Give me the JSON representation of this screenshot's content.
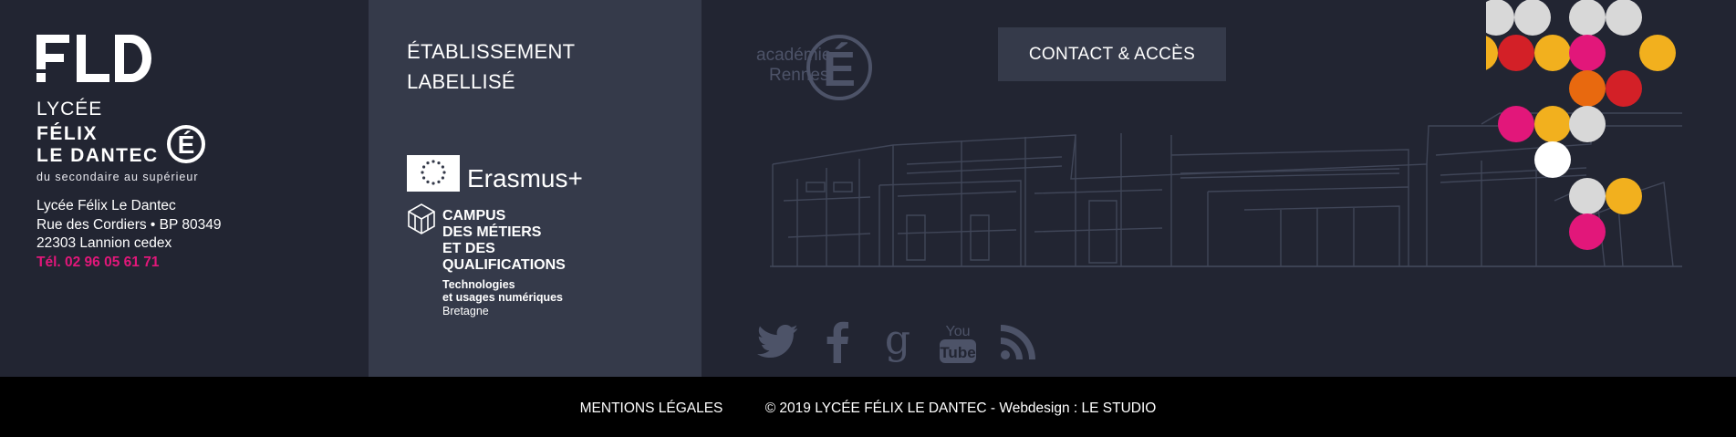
{
  "brand": {
    "logo_text": "FLD",
    "lycee": "LYCÉE",
    "name_line1": "FÉLIX",
    "name_line2": "LE DANTEC",
    "tagline": "du secondaire au supérieur",
    "e_mark": "É"
  },
  "address": {
    "line1": "Lycée Félix Le Dantec",
    "line2": "Rue des Cordiers • BP 80349",
    "line3": "22303 Lannion cedex",
    "phone": "Tél. 02 96 05 61 71"
  },
  "labels": {
    "title_line1": "ÉTABLISSEMENT",
    "title_line2": "LABELLISÉ",
    "erasmus": "Erasmus+",
    "campus_line1": "CAMPUS",
    "campus_line2": "DES MÉTIERS",
    "campus_line3": "ET DES",
    "campus_line4": "QUALIFICATIONS",
    "campus_line5": "Technologies",
    "campus_line6": "et usages numériques",
    "campus_line7": "Bretagne"
  },
  "academie": {
    "line1": "académie",
    "line2": "Rennes",
    "e_mark": "É"
  },
  "contact_button": "CONTACT & ACCÈS",
  "socials": [
    {
      "icon": "twitter-icon"
    },
    {
      "icon": "facebook-icon"
    },
    {
      "icon": "google-plus-icon",
      "glyph": "g"
    },
    {
      "icon": "youtube-icon",
      "glyph_top": "You",
      "glyph_bottom": "Tube"
    },
    {
      "icon": "rss-icon"
    }
  ],
  "footer": {
    "mentions": "MENTIONS LÉGALES",
    "copyright": "© 2019 LYCÉE FÉLIX LE DANTEC - Webdesign : LE STUDIO"
  },
  "colors": {
    "background": "#222532",
    "panel": "#353a4a",
    "bottom_bar": "#000000",
    "phone_accent": "#e2177a",
    "icon_muted": "#4d5368",
    "dot_palette": [
      "#d32027",
      "#f2b01e",
      "#e2177a",
      "#e8690f",
      "#d8d8d8",
      "#ffffff"
    ]
  }
}
